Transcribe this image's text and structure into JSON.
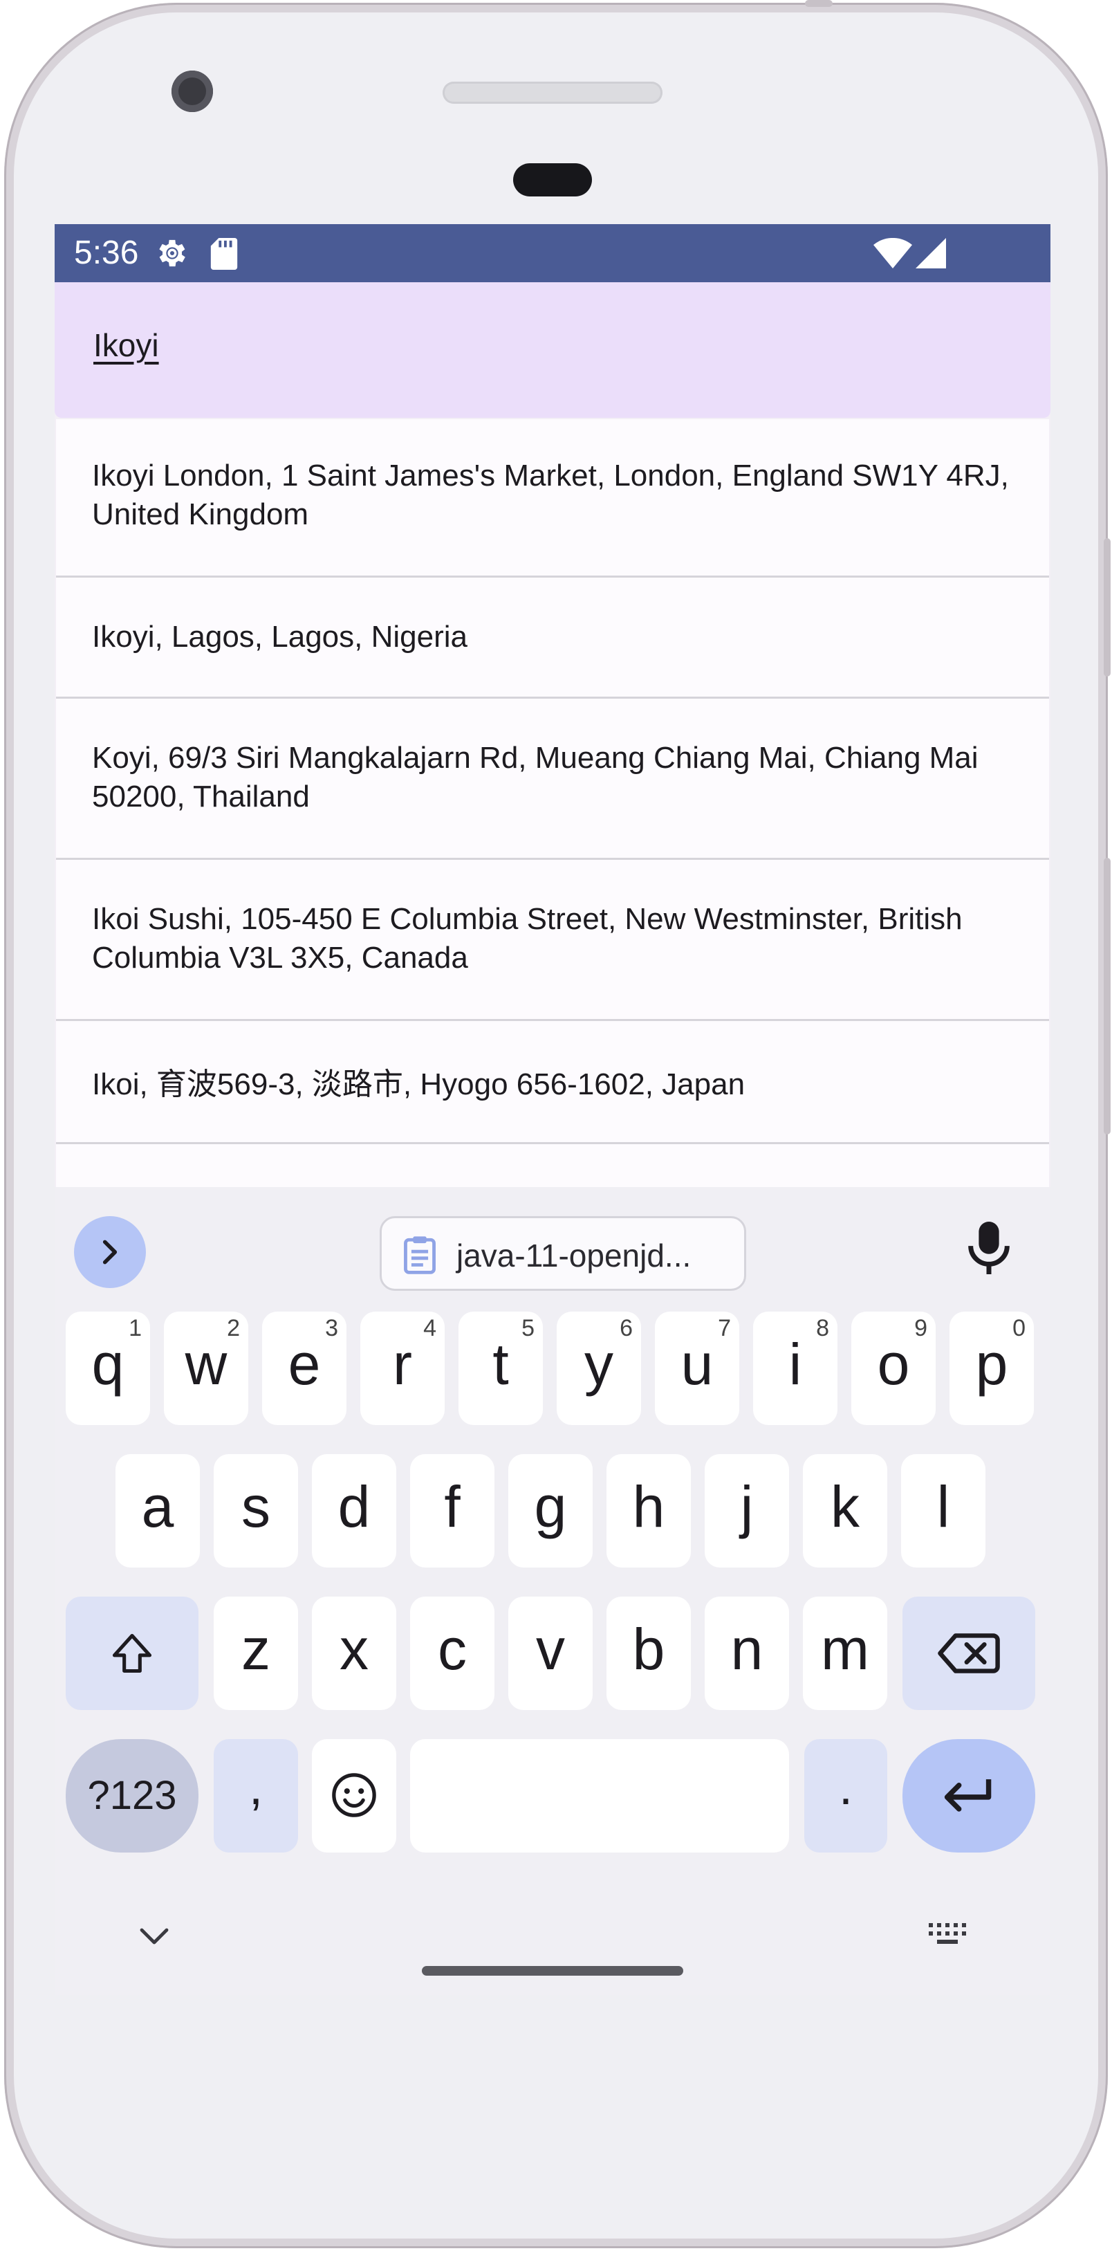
{
  "status_bar": {
    "time": "5:36",
    "icons": [
      "gear-icon",
      "sd-card-icon",
      "wifi-icon",
      "cell-signal-icon"
    ],
    "background": "#4a5b95"
  },
  "search": {
    "value": "Ikoyi",
    "background": "#ebdefa"
  },
  "results": [
    {
      "text": "Ikoyi London, 1 Saint James's Market, London, England SW1Y 4RJ, United Kingdom"
    },
    {
      "text": "Ikoyi, Lagos, Lagos, Nigeria"
    },
    {
      "text": "Koyi, 69/3 Siri Mangkalajarn Rd, Mueang Chiang Mai, Chiang Mai 50200, Thailand"
    },
    {
      "text": "Ikoi Sushi, 105-450 E Columbia Street, New Westminster, British Columbia V3L 3X5, Canada"
    },
    {
      "text": "Ikoi, 育波569-3, 淡路市, Hyogo 656-1602, Japan"
    }
  ],
  "keyboard": {
    "clipboard_chip": "java-11-openjd...",
    "row1": [
      {
        "key": "q",
        "hint": "1"
      },
      {
        "key": "w",
        "hint": "2"
      },
      {
        "key": "e",
        "hint": "3"
      },
      {
        "key": "r",
        "hint": "4"
      },
      {
        "key": "t",
        "hint": "5"
      },
      {
        "key": "y",
        "hint": "6"
      },
      {
        "key": "u",
        "hint": "7"
      },
      {
        "key": "i",
        "hint": "8"
      },
      {
        "key": "o",
        "hint": "9"
      },
      {
        "key": "p",
        "hint": "0"
      }
    ],
    "row2": [
      "a",
      "s",
      "d",
      "f",
      "g",
      "h",
      "j",
      "k",
      "l"
    ],
    "row3": [
      "z",
      "x",
      "c",
      "v",
      "b",
      "n",
      "m"
    ],
    "symbols_label": "?123",
    "comma": ",",
    "period": ".",
    "accent": "#b5c5f6"
  }
}
